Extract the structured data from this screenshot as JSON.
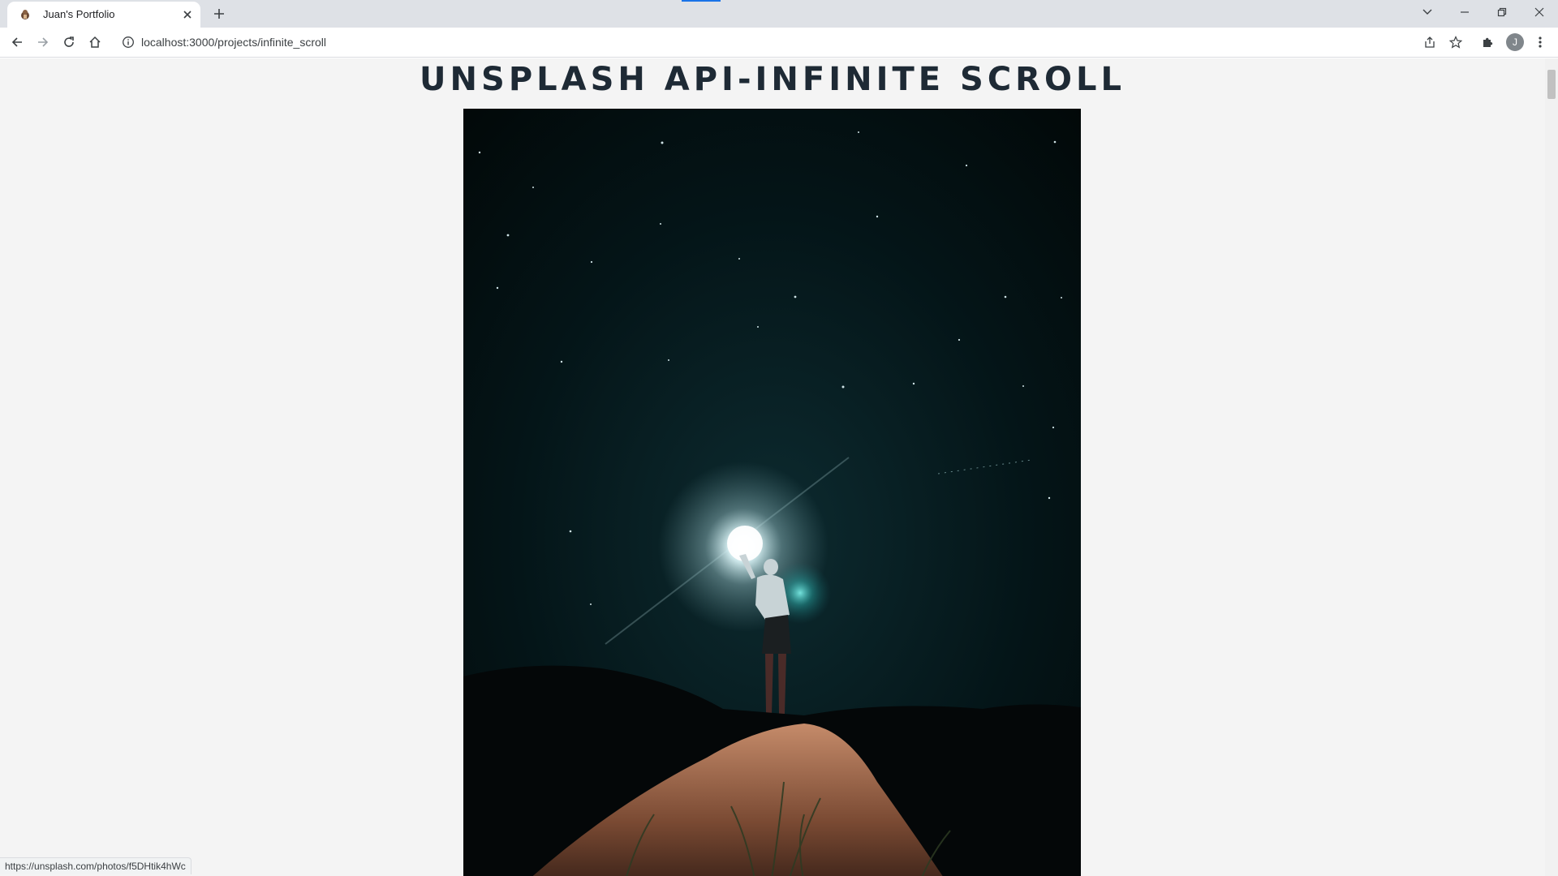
{
  "browser": {
    "tab_title": "Juan's Portfolio",
    "url": "localhost:3000/projects/infinite_scroll",
    "profile_initial": "J",
    "status_url": "https://unsplash.com/photos/f5DHtik4hWc",
    "icons": [
      "tab-favicon-icon",
      "close-icon",
      "plus-icon",
      "chevron-down-icon",
      "minimize-icon",
      "restore-icon",
      "close-window-icon",
      "back-icon",
      "forward-icon",
      "reload-icon",
      "home-icon",
      "info-icon",
      "share-icon",
      "star-icon",
      "puzzle-icon",
      "kebab-menu-icon"
    ]
  },
  "page": {
    "title": "Unsplash API-Infinite Scroll",
    "photo": {
      "subject": "person holding a glowing light on a rock under a starry night sky"
    }
  },
  "colors": {
    "page_background": "#f4f4f4",
    "title_color": "#1e2a35",
    "tab_strip": "#dee1e6"
  }
}
